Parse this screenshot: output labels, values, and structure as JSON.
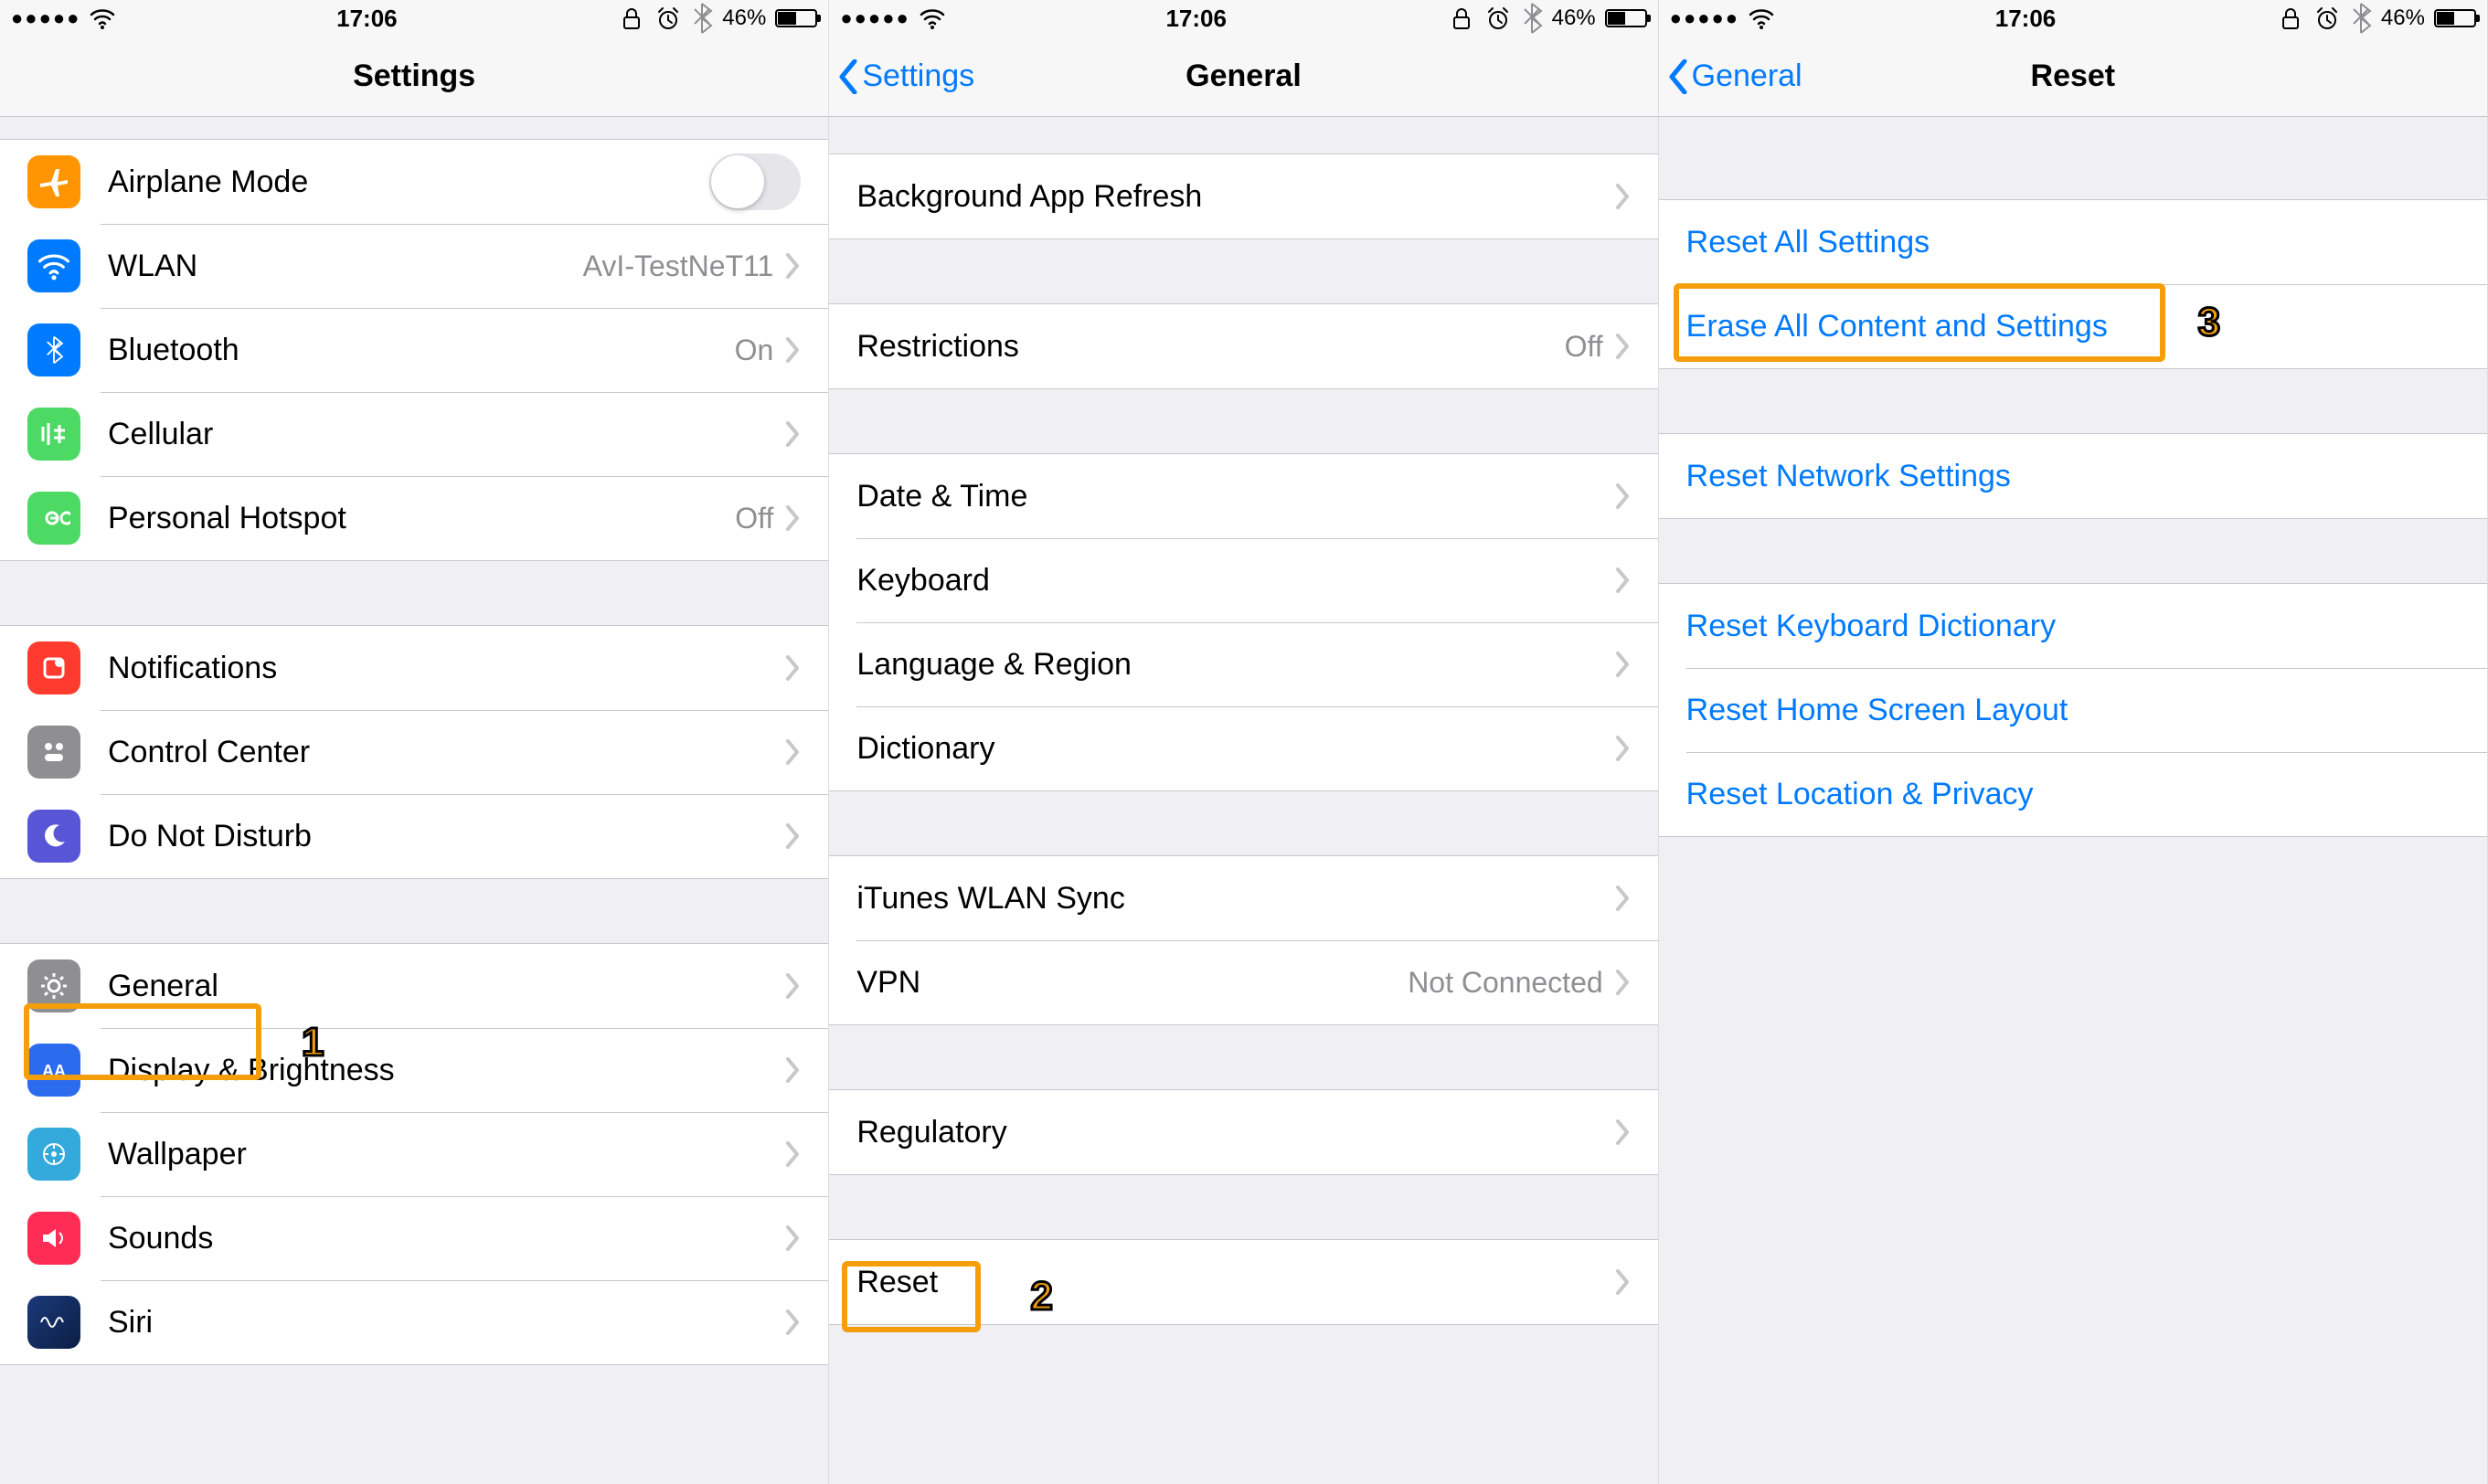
{
  "status": {
    "time": "17:06",
    "battery_pct": "46%"
  },
  "screen1": {
    "title": "Settings",
    "rows": {
      "airplane": "Airplane Mode",
      "wlan": "WLAN",
      "wlan_value": "AvI-TestNeT11",
      "bluetooth": "Bluetooth",
      "bluetooth_value": "On",
      "cellular": "Cellular",
      "hotspot": "Personal Hotspot",
      "hotspot_value": "Off",
      "notifications": "Notifications",
      "control_center": "Control Center",
      "dnd": "Do Not Disturb",
      "general": "General",
      "display": "Display & Brightness",
      "wallpaper": "Wallpaper",
      "sounds": "Sounds",
      "siri": "Siri"
    },
    "step": "1"
  },
  "screen2": {
    "back": "Settings",
    "title": "General",
    "rows": {
      "bg_refresh": "Background App Refresh",
      "restrictions": "Restrictions",
      "restrictions_value": "Off",
      "date_time": "Date & Time",
      "keyboard": "Keyboard",
      "lang_region": "Language & Region",
      "dictionary": "Dictionary",
      "itunes_sync": "iTunes WLAN Sync",
      "vpn": "VPN",
      "vpn_value": "Not Connected",
      "regulatory": "Regulatory",
      "reset": "Reset"
    },
    "step": "2"
  },
  "screen3": {
    "back": "General",
    "title": "Reset",
    "rows": {
      "reset_all": "Reset All Settings",
      "erase_all": "Erase All Content and Settings",
      "reset_network": "Reset Network Settings",
      "reset_keyboard": "Reset Keyboard Dictionary",
      "reset_home": "Reset Home Screen Layout",
      "reset_location": "Reset Location & Privacy"
    },
    "step": "3"
  }
}
